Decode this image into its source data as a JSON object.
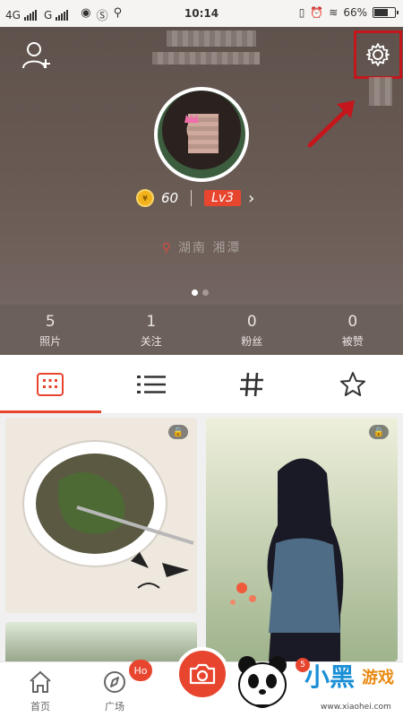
{
  "status_bar": {
    "network1": "4G",
    "network2": "G",
    "time": "10:14",
    "battery_text": "66%",
    "battery_level": 0.66
  },
  "profile": {
    "location": "湖南 湘潭",
    "coins": "60",
    "level": "Lv3"
  },
  "stats": [
    {
      "value": "5",
      "label": "照片"
    },
    {
      "value": "1",
      "label": "关注"
    },
    {
      "value": "0",
      "label": "粉丝"
    },
    {
      "value": "0",
      "label": "被赞"
    }
  ],
  "bottom_nav": {
    "home_label": "首页",
    "plaza_label": "广场",
    "plaza_badge": "Ho"
  },
  "colors": {
    "accent": "#e8452f",
    "header_bg": "#5f524c",
    "stats_bg": "#6c605b",
    "highlight_box": "#c4161c"
  },
  "watermark": {
    "logo_text_blue": "小黑",
    "logo_text_orange": "游戏",
    "url": "www.xiaohei.com",
    "badge": "5"
  },
  "icons": {
    "add_friend": "add-user-icon",
    "settings": "gear-icon",
    "grid_tab": "grid-icon",
    "list_tab": "list-icon",
    "tag_tab": "hashtag-icon",
    "fav_tab": "star-icon",
    "home": "home-icon",
    "plaza": "compass-icon",
    "camera": "camera-icon",
    "lock": "lock-icon"
  }
}
